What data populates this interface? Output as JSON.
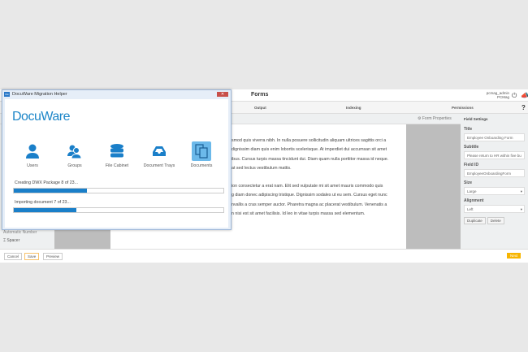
{
  "app": {
    "title": "Forms",
    "user": "pcmag_admin",
    "org": "PCMag",
    "steps": [
      "Output",
      "Indexing",
      "Permissions"
    ],
    "form_properties": "Form Properties",
    "body_paragraphs": [
      "smod quis viverra nibh. In nulla posuere sollicitudin aliquam ultrices sagittis orci a",
      "dignissim diam quis enim lobortis scelerisque. At imperdiet dui accumsan sit amet",
      "ibus. Cursus turpis massa tincidunt dui. Diam quam nulla porttitor massa id neque.",
      "at sed lectus vestibulum mattis."
    ],
    "body_paragraphs2": [
      "ion consectetur a erat nam. Elit sed vulputate mi sit amet mauris commodo quis",
      "g diam donec adipiscing tristique. Dignissim sodales ut eu sem. Cursus eget nunc",
      "nvallis a cras semper auctor. Pharetra magna ac placerat vestibulum. Venenatis a",
      "n nisi est sit amet facilisis. Id leo in vitae turpis massa sed elementum."
    ],
    "sidebar": {
      "item_cut": "Automatic Number",
      "spacer": "Spacer"
    },
    "panel": {
      "heading": "Field Settings",
      "title_label": "Title",
      "title_value": "Employee Onboarding Form",
      "subtitle_label": "Subtitle",
      "subtitle_value": "Please return to HR within five bu",
      "fieldid_label": "Field ID",
      "fieldid_value": "EmployeeOnboardingForm",
      "size_label": "Size",
      "size_value": "Large",
      "align_label": "Alignment",
      "align_value": "Left",
      "duplicate": "Duplicate",
      "delete": "Delete"
    },
    "footer": {
      "cancel": "Cancel",
      "save": "Save",
      "preview": "Preview",
      "next": "Next"
    }
  },
  "dialog": {
    "title": "DocuWare Migration Helper",
    "logo": "DocuWare",
    "icons": [
      {
        "label": "Users"
      },
      {
        "label": "Groups"
      },
      {
        "label": "File Cabinet"
      },
      {
        "label": "Document Trays"
      },
      {
        "label": "Documents"
      }
    ],
    "progress1": {
      "label": "Creating DWX Package 8 of 23...",
      "percent": 35
    },
    "progress2": {
      "label": "Importing document 7 of 23...",
      "percent": 30
    }
  }
}
